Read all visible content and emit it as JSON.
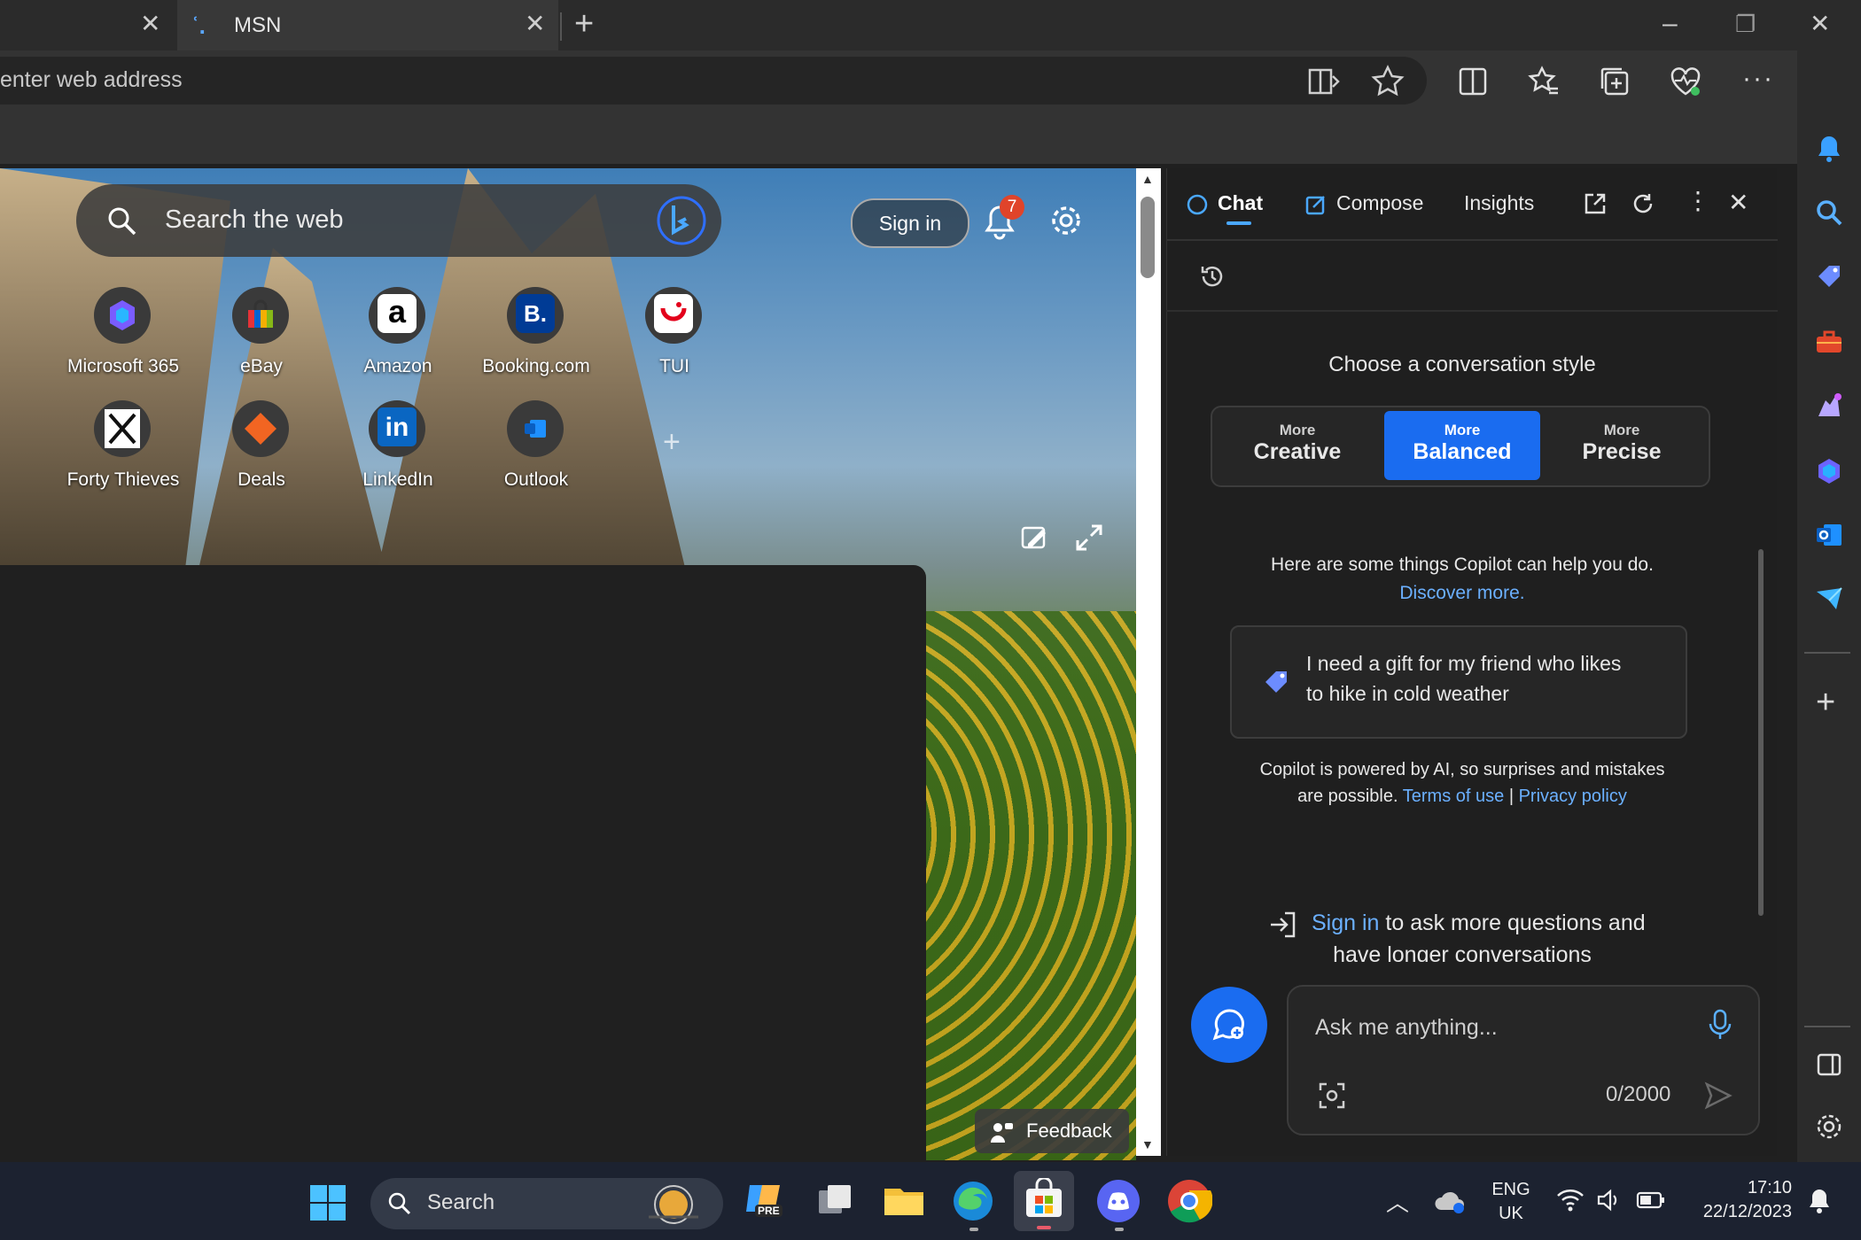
{
  "browser": {
    "tabs": [
      {
        "label": ""
      },
      {
        "label": "MSN"
      }
    ],
    "address_placeholder": "enter web address",
    "window_controls": {
      "minimize": "–",
      "maximize": "❐",
      "close": "✕"
    }
  },
  "page": {
    "search_placeholder": "Search the web",
    "sign_in": "Sign in",
    "notification_count": "7",
    "tiles": [
      {
        "label": "Microsoft 365"
      },
      {
        "label": "eBay"
      },
      {
        "label": "Amazon"
      },
      {
        "label": "Booking.com"
      },
      {
        "label": "TUI"
      },
      {
        "label": "Forty Thieves"
      },
      {
        "label": "Deals"
      },
      {
        "label": "LinkedIn"
      },
      {
        "label": "Outlook"
      }
    ],
    "feedback": "Feedback"
  },
  "copilot": {
    "tabs": {
      "chat": "Chat",
      "compose": "Compose",
      "insights": "Insights"
    },
    "style_heading": "Choose a conversation style",
    "styles": [
      {
        "small": "More",
        "big": "Creative",
        "selected": false
      },
      {
        "small": "More",
        "big": "Balanced",
        "selected": true
      },
      {
        "small": "More",
        "big": "Precise",
        "selected": false
      }
    ],
    "help_text": "Here are some things Copilot can help you do.",
    "discover": "Discover more.",
    "suggestion_line1": "I need a gift for my friend who likes",
    "suggestion_line2": "to hike in cold weather",
    "disclaimer_line1": "Copilot is powered by AI, so surprises and mistakes",
    "disclaimer_line2": "are possible.",
    "terms": "Terms of use",
    "separator": "|",
    "privacy": "Privacy policy",
    "signin_link": "Sign in",
    "signin_rest": "to ask more questions and",
    "signin_line2": "have longer conversations",
    "ask_placeholder": "Ask me anything...",
    "char_count": "0/2000"
  },
  "taskbar": {
    "search": "Search",
    "lang1": "ENG",
    "lang2": "UK",
    "time": "17:10",
    "date": "22/12/2023",
    "pre_badge": "PRE"
  },
  "colors": {
    "accent": "#1a6cf0",
    "link": "#6bb0ff"
  }
}
